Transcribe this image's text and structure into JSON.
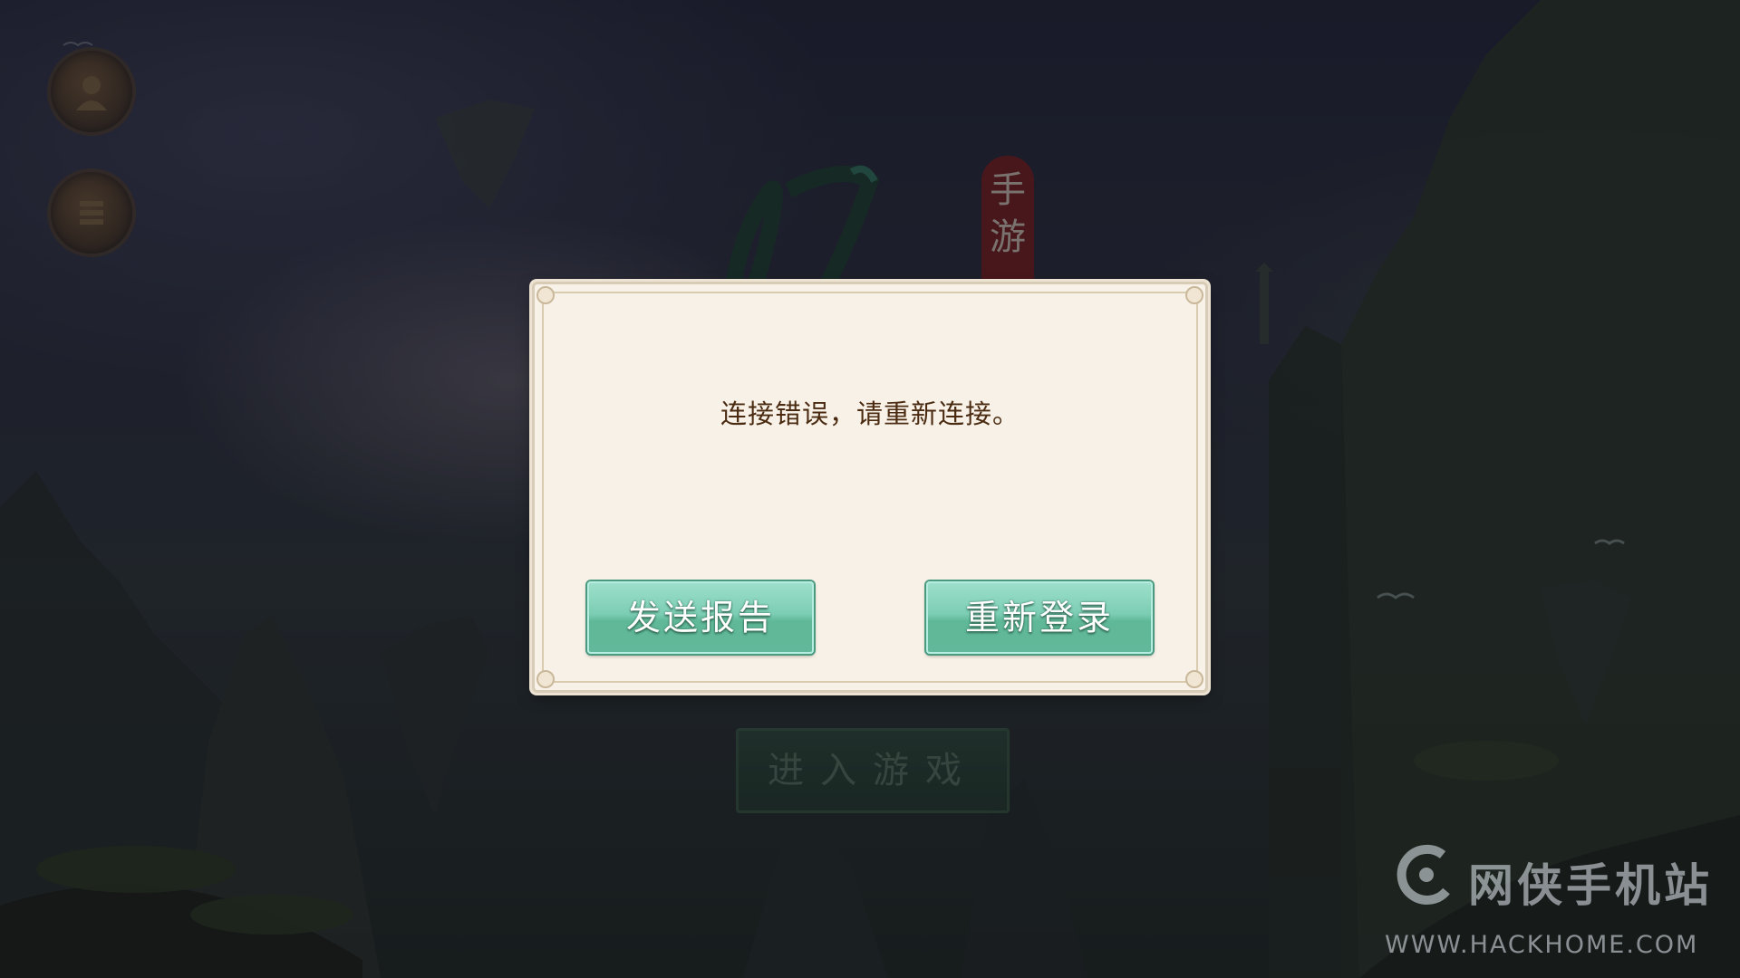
{
  "background": {
    "scene": "mountain-landscape"
  },
  "side_buttons": [
    {
      "icon": "portrait-icon"
    },
    {
      "icon": "menu-icon"
    }
  ],
  "logo": {
    "seal_text_1": "手",
    "seal_text_2": "游"
  },
  "enter_game": {
    "label": "进入游戏"
  },
  "dialog": {
    "message": "连接错误，请重新连接。",
    "buttons": {
      "send_report": "发送报告",
      "relogin": "重新登录"
    }
  },
  "watermark": {
    "title": "网侠手机站",
    "url": "WWW.HACKHOME.COM"
  },
  "colors": {
    "dialog_bg": "#f8f1e7",
    "message_text": "#4a2a10",
    "button_green": "#7ccdb4"
  }
}
